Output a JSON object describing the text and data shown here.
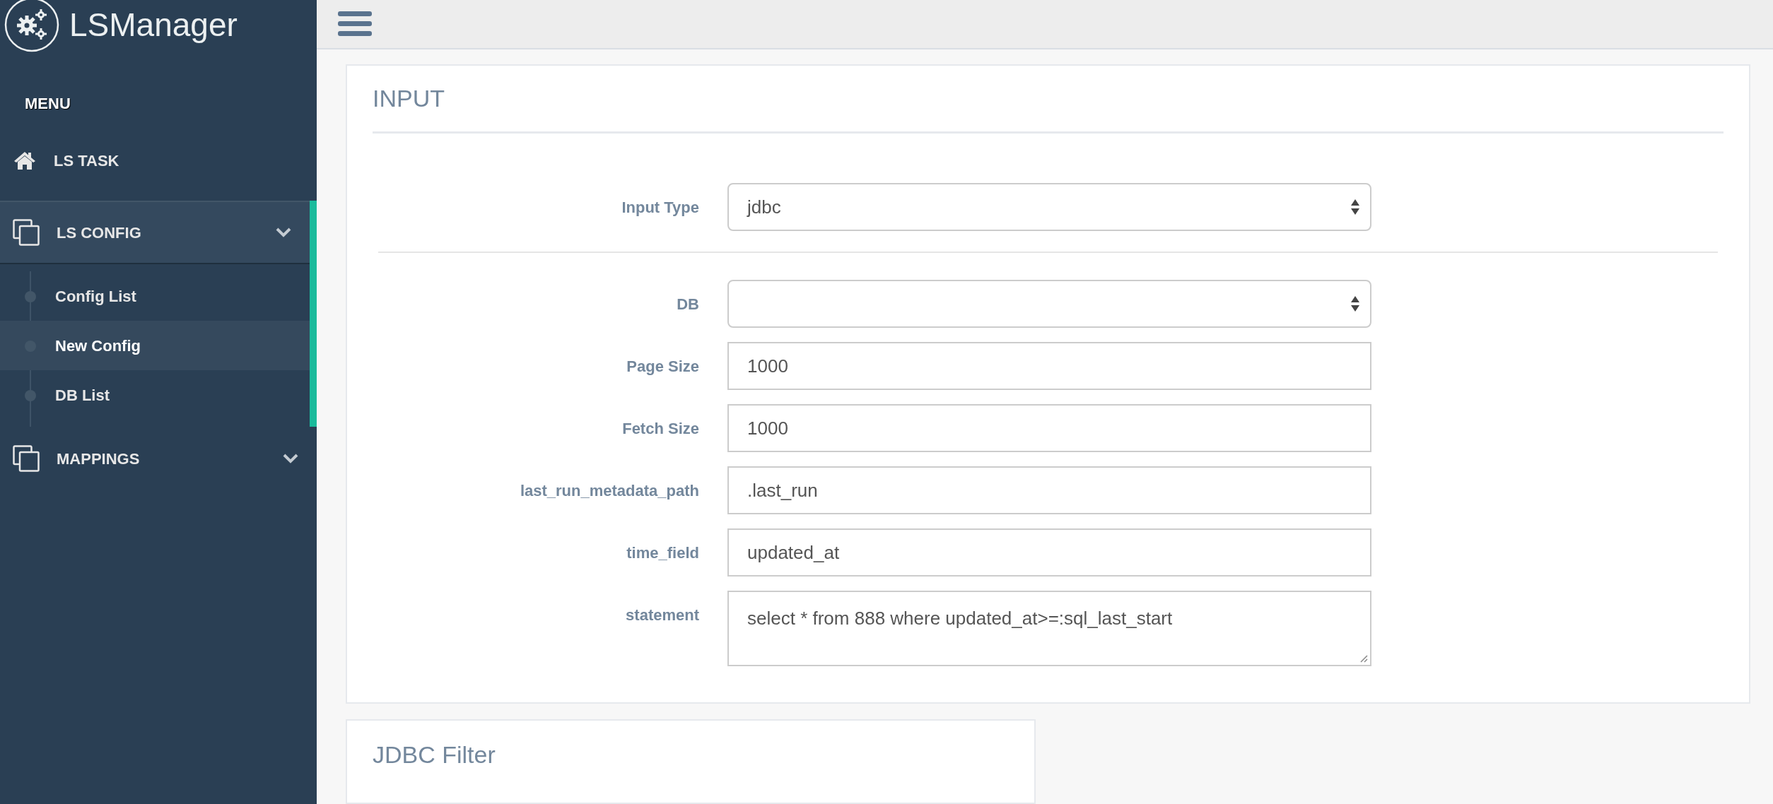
{
  "brand": {
    "name": "LSManager"
  },
  "menu_heading": "MENU",
  "nav": [
    {
      "kind": "link",
      "label": "LS TASK"
    },
    {
      "kind": "group",
      "label": "LS CONFIG",
      "expanded": true,
      "children": [
        {
          "label": "Config List",
          "selected": false
        },
        {
          "label": "New Config",
          "selected": true
        },
        {
          "label": "DB List",
          "selected": false
        }
      ]
    },
    {
      "kind": "group",
      "label": "MAPPINGS",
      "expanded": false
    }
  ],
  "panels": [
    {
      "title": "INPUT",
      "sections": [
        [
          {
            "kind": "select",
            "label": "Input Type",
            "value": "jdbc"
          }
        ],
        [
          {
            "kind": "select",
            "label": "DB"
          },
          {
            "kind": "text",
            "label": "Page Size",
            "value": "1000"
          },
          {
            "kind": "text",
            "label": "Fetch Size",
            "value": "1000"
          },
          {
            "kind": "text",
            "label": "last_run_metadata_path",
            "value": ".last_run"
          },
          {
            "kind": "text",
            "label": "time_field",
            "value": "updated_at"
          },
          {
            "kind": "textarea",
            "label": "statement",
            "value": "select * from 888 where updated_at>=:sql_last_start"
          }
        ]
      ]
    },
    {
      "title": "JDBC Filter"
    }
  ]
}
